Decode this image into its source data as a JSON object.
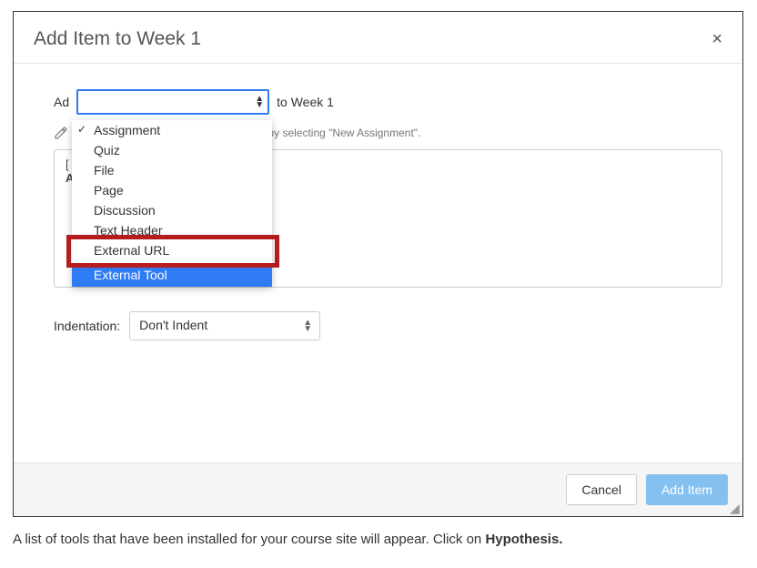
{
  "dialog": {
    "title": "Add Item to Week 1",
    "add_prefix": "Ad",
    "add_suffix": "to Week 1",
    "hint_text": "with this module, or add an assignment by selecting \"New Assignment\".",
    "list_placeholder_l1": "[",
    "list_placeholder_l2": "A",
    "indent_label": "Indentation:",
    "indent_value": "Don't Indent",
    "cancel": "Cancel",
    "submit": "Add Item"
  },
  "dropdown": {
    "items": [
      {
        "label": "Assignment",
        "checked": true
      },
      {
        "label": "Quiz"
      },
      {
        "label": "File"
      },
      {
        "label": "Page"
      },
      {
        "label": "Discussion"
      },
      {
        "label": "Text Header"
      },
      {
        "label": "External URL"
      },
      {
        "label": "External Tool",
        "selected": true
      }
    ]
  },
  "caption": {
    "text_before": "A list of tools that have been installed for your course site will appear. Click on ",
    "bold": "Hypothesis."
  }
}
